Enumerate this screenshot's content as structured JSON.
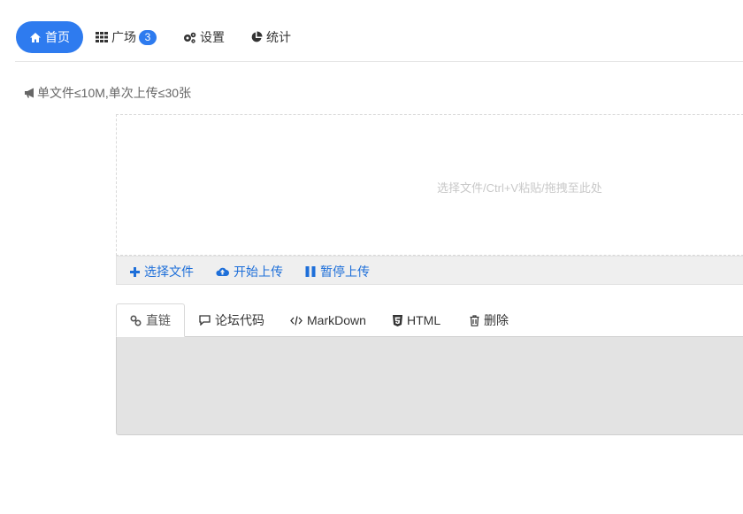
{
  "nav": {
    "items": [
      {
        "label": "首页",
        "icon": "home-icon",
        "active": true
      },
      {
        "label": "广场",
        "icon": "grid-icon",
        "badge": "3"
      },
      {
        "label": "设置",
        "icon": "gears-icon"
      },
      {
        "label": "统计",
        "icon": "pie-chart-icon"
      }
    ]
  },
  "notice": {
    "text": "单文件≤10M,单次上传≤30张",
    "icon": "bullhorn-icon"
  },
  "upload": {
    "dropzone_hint": "选择文件/Ctrl+V粘贴/拖拽至此处",
    "buttons": {
      "select": "选择文件",
      "start": "开始上传",
      "pause": "暂停上传"
    }
  },
  "result_tabs": {
    "items": [
      {
        "label": "直链",
        "icon": "link-icon",
        "active": true
      },
      {
        "label": "论坛代码",
        "icon": "comment-icon"
      },
      {
        "label": "MarkDown",
        "icon": "code-icon"
      },
      {
        "label": "HTML",
        "icon": "html5-icon"
      },
      {
        "label": "删除",
        "icon": "trash-icon"
      }
    ]
  },
  "colors": {
    "accent": "#2e7bef",
    "link": "#1e6fd9",
    "panel_bg": "#e3e3e3",
    "toolbar_bg": "#efefef"
  }
}
